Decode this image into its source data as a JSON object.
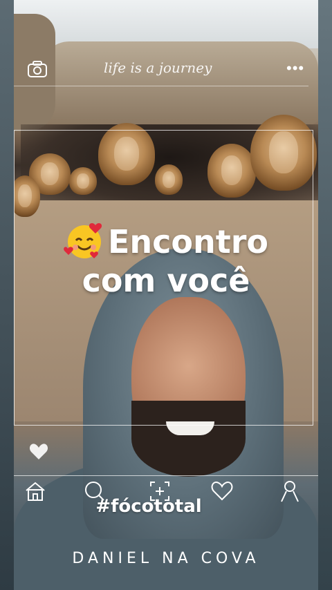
{
  "header": {
    "script_text": "life is a journey",
    "more_icon": "more-dots-icon",
    "camera_icon": "camera-icon"
  },
  "overlay": {
    "title_line1": "Encontro",
    "title_line2": "com você",
    "emoji": "smiling-face-with-hearts"
  },
  "nav": {
    "items": [
      "home-icon",
      "search-icon",
      "add-icon",
      "heart-icon",
      "profile-icon"
    ],
    "like_icon": "heart-icon"
  },
  "hashtag": "#fócototal",
  "footer": "DANIEL NA COVA",
  "colors": {
    "text": "#ffffff",
    "frame": "#ffffff"
  }
}
